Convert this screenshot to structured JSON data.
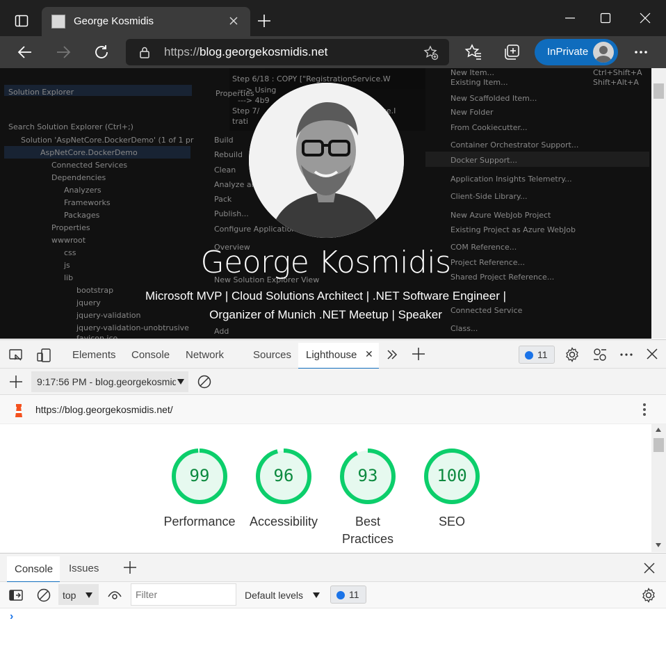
{
  "browser": {
    "tab_title": "George Kosmidis",
    "url_scheme": "https://",
    "url_host": "blog.georgekosmidis.net",
    "inprivate_label": "InPrivate"
  },
  "page": {
    "name": "George Kosmidis",
    "tagline_line1": "Microsoft MVP | Cloud Solutions Architect | .NET Software Engineer |",
    "tagline_line2": "Organizer of Munich .NET Meetup | Speaker",
    "background_text": [
      "Solution Explorer",
      "Search Solution Explorer (Ctrl+;)",
      "Solution 'AspNetCore.DockerDemo' (1 of 1 pr",
      "AspNetCore.DockerDemo",
      "Connected Services",
      "Dependencies",
      "Analyzers",
      "Frameworks",
      "Packages",
      "Properties",
      "wwwroot",
      "css",
      "js",
      "lib",
      "bootstrap",
      "jquery",
      "jquery-validation",
      "jquery-validation-unobtrusive",
      "favicon.ico",
      "Build",
      "Rebuild",
      "Clean",
      "Analyze and",
      "Pack",
      "Publish...",
      "Configure Application",
      "Overview",
      "New Solution Explorer View",
      "Step 6/18 : COPY [\"RegistrationService.W",
      "---> Using",
      "---> 4b9",
      "Step 7/",
      "Service.I",
      "trati",
      "New Item...",
      "Existing Item...",
      "New Scaffolded Item...",
      "New Folder",
      "From Cookiecutter...",
      "Container Orchestrator Support...",
      "Docker Support...",
      "Application Insights Telemetry...",
      "Client-Side Library...",
      "New Azure WebJob Project",
      "Existing Project as Azure WebJob",
      "COM Reference...",
      "Project Reference...",
      "Shared Project Reference...",
      "Connected Service",
      "Class...",
      "Shift+Alt+A",
      "Ctrl+Shift+A",
      "Add",
      "Properties"
    ]
  },
  "devtools": {
    "tabs": [
      "Elements",
      "Console",
      "Network",
      "Sources"
    ],
    "active_tab": "Lighthouse",
    "issues_count": "11",
    "report_selector": "9:17:56 PM - blog.georgekosmidis.net",
    "report_url": "https://blog.georgekosmidis.net/",
    "scores": [
      {
        "label": "Performance",
        "value": "99",
        "score": 99
      },
      {
        "label": "Accessibility",
        "value": "96",
        "score": 96
      },
      {
        "label": "Best\nPractices",
        "label_line1": "Best",
        "label_line2": "Practices",
        "value": "93",
        "score": 93
      },
      {
        "label": "SEO",
        "value": "100",
        "score": 100
      }
    ],
    "score_color": "#0cce6b"
  },
  "drawer": {
    "tabs": [
      "Console",
      "Issues"
    ],
    "context": "top",
    "filter_placeholder": "Filter",
    "levels": "Default levels",
    "issues_count": "11",
    "prompt": "›"
  }
}
